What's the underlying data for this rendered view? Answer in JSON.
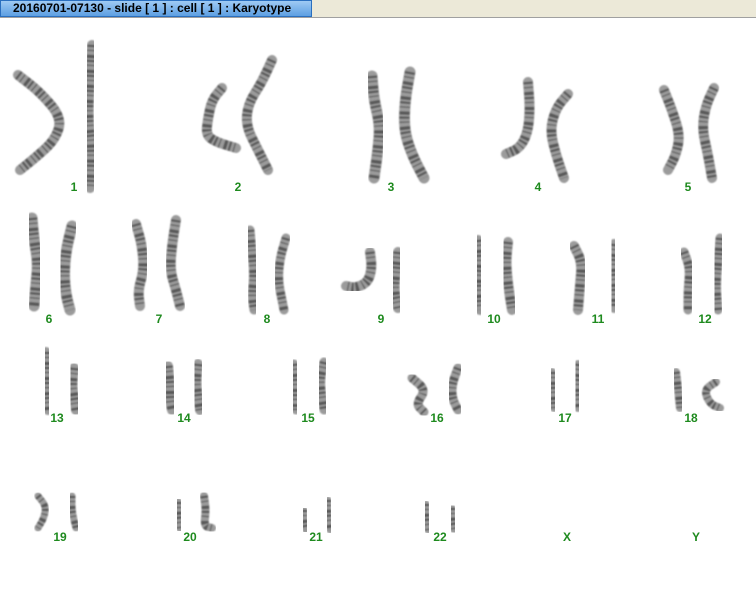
{
  "window": {
    "title": "20160701-07130 - slide [ 1 ] : cell [ 1 ] : Karyotype"
  },
  "karyotype": {
    "pairs": [
      {
        "label": "1",
        "chromosomes": 2
      },
      {
        "label": "2",
        "chromosomes": 2
      },
      {
        "label": "3",
        "chromosomes": 2
      },
      {
        "label": "4",
        "chromosomes": 2
      },
      {
        "label": "5",
        "chromosomes": 2
      },
      {
        "label": "6",
        "chromosomes": 2
      },
      {
        "label": "7",
        "chromosomes": 2
      },
      {
        "label": "8",
        "chromosomes": 2
      },
      {
        "label": "9",
        "chromosomes": 2
      },
      {
        "label": "10",
        "chromosomes": 2
      },
      {
        "label": "11",
        "chromosomes": 2
      },
      {
        "label": "12",
        "chromosomes": 2
      },
      {
        "label": "13",
        "chromosomes": 2
      },
      {
        "label": "14",
        "chromosomes": 2
      },
      {
        "label": "15",
        "chromosomes": 2
      },
      {
        "label": "16",
        "chromosomes": 2
      },
      {
        "label": "17",
        "chromosomes": 2
      },
      {
        "label": "18",
        "chromosomes": 2
      },
      {
        "label": "19",
        "chromosomes": 2
      },
      {
        "label": "20",
        "chromosomes": 2
      },
      {
        "label": "21",
        "chromosomes": 2
      },
      {
        "label": "22",
        "chromosomes": 2
      },
      {
        "label": "X",
        "chromosomes": 0
      },
      {
        "label": "Y",
        "chromosomes": 0
      }
    ],
    "label_color": "#1e8a1e"
  }
}
